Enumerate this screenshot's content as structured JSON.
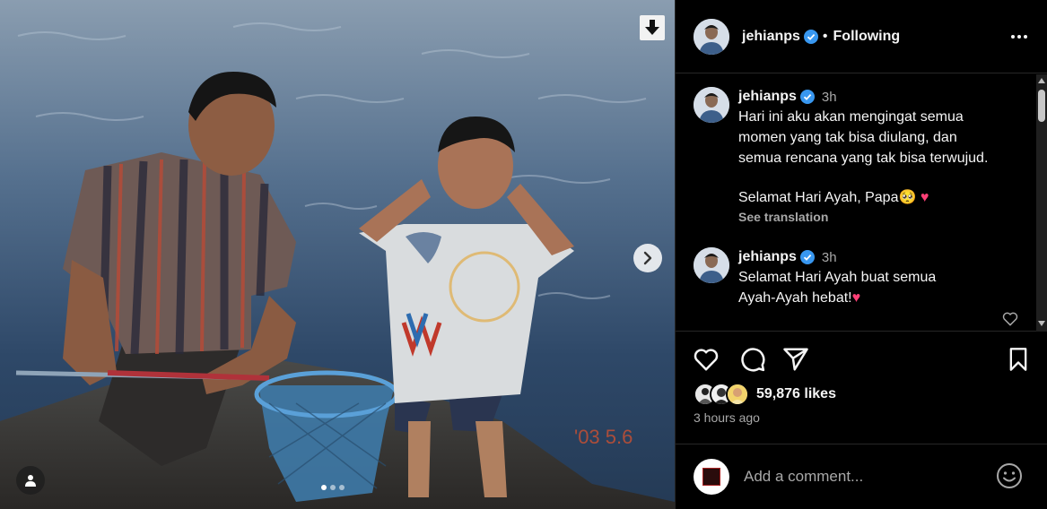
{
  "post": {
    "username": "jehianps",
    "follow_status": "Following",
    "separator": "•",
    "likes": "59,876 likes",
    "time_ago": "3 hours ago"
  },
  "comments": [
    {
      "username": "jehianps",
      "time": "3h",
      "lines": [
        "Hari ini aku akan mengingat semua",
        "momen yang tak bisa diulang, dan",
        "semua rencana yang tak bisa terwujud."
      ],
      "line2": "Selamat Hari Ayah, Papa🥺 ",
      "heart": "♥",
      "see_translation": "See translation"
    },
    {
      "username": "jehianps",
      "time": "3h",
      "lines": [
        "Selamat Hari Ayah buat semua",
        "Ayah-Ayah hebat!"
      ],
      "heart": "♥"
    }
  ],
  "add_comment": {
    "placeholder": "Add a comment..."
  },
  "photo": {
    "stamp": "'03 5.6"
  },
  "icons": {
    "download": "download-arrow-icon",
    "next": "chevron-right-icon",
    "tag": "user-tag-icon",
    "more": "more-options-icon",
    "like": "heart-outline-icon",
    "comment": "speech-bubble-icon",
    "share": "paper-plane-icon",
    "save": "bookmark-icon",
    "emoji": "smiley-icon",
    "verified": "verified-badge-icon"
  },
  "colors": {
    "verified": "#3897f0",
    "heart": "#ff3f76",
    "secondary_text": "#a8a8a8",
    "border": "#262626"
  },
  "carousel": {
    "total": 3,
    "active": 0
  }
}
